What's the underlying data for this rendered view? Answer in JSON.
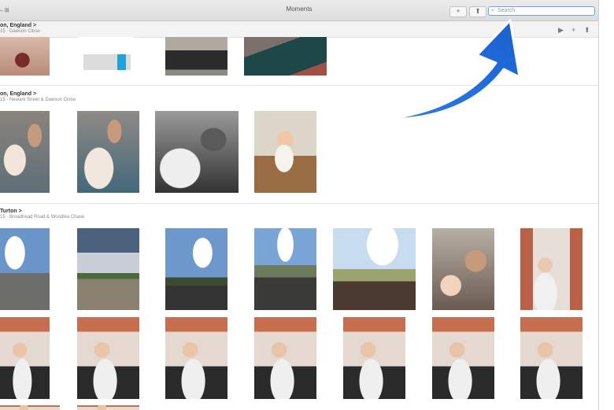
{
  "window": {
    "title": "Moments",
    "left_glyphs": "– ⊞"
  },
  "toolbar": {
    "add_label": "+",
    "share_label": "⬆",
    "search": {
      "placeholder": "Search",
      "icon": "magnifier-icon"
    }
  },
  "subbar": {
    "play": "▶",
    "add": "+",
    "share": "⬆"
  },
  "moments": [
    {
      "title": "on, England",
      "chevron": ">",
      "subtitle": "15 · Dawson Close"
    },
    {
      "title": "on, England",
      "chevron": ">",
      "subtitle": "15 · Newark Street & Dawson Close"
    },
    {
      "title": "Turton",
      "chevron": ">",
      "subtitle": "15 · Broadhead Road & Woodlea Chase"
    }
  ],
  "annotation": {
    "arrow_color": "#1f72e6"
  },
  "colors": {
    "accent": "#6fa3e6"
  }
}
